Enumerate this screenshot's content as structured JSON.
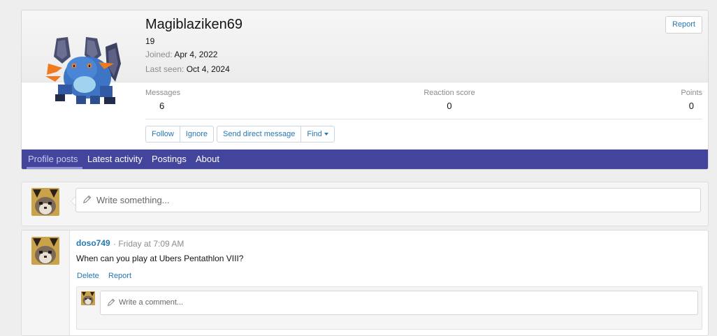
{
  "profile": {
    "username": "Magiblaziken69",
    "user_title": "19",
    "joined_label": "Joined:",
    "joined_value": "Apr 4, 2022",
    "last_seen_label": "Last seen:",
    "last_seen_value": "Oct 4, 2024",
    "report_label": "Report",
    "stats": {
      "messages_label": "Messages",
      "messages_value": "6",
      "reaction_label": "Reaction score",
      "reaction_value": "0",
      "points_label": "Points",
      "points_value": "0"
    },
    "actions": {
      "follow": "Follow",
      "ignore": "Ignore",
      "send_dm": "Send direct message",
      "find": "Find"
    },
    "avatar_icon": "swampert-sprite-avatar"
  },
  "tabs": {
    "profile_posts": "Profile posts",
    "latest_activity": "Latest activity",
    "postings": "Postings",
    "about": "About"
  },
  "composer": {
    "placeholder": "Write something...",
    "avatar_icon": "cat-avatar"
  },
  "post": {
    "author": "doso749",
    "timestamp": "· Friday at 7:09 AM",
    "body": "When can you play at Ubers Pentathlon VIII?",
    "delete_label": "Delete",
    "report_label": "Report",
    "comment_placeholder": "Write a comment..."
  },
  "colors": {
    "nav_bg": "#43449b",
    "link": "#2577b1",
    "page_bg": "#eeeeee"
  }
}
